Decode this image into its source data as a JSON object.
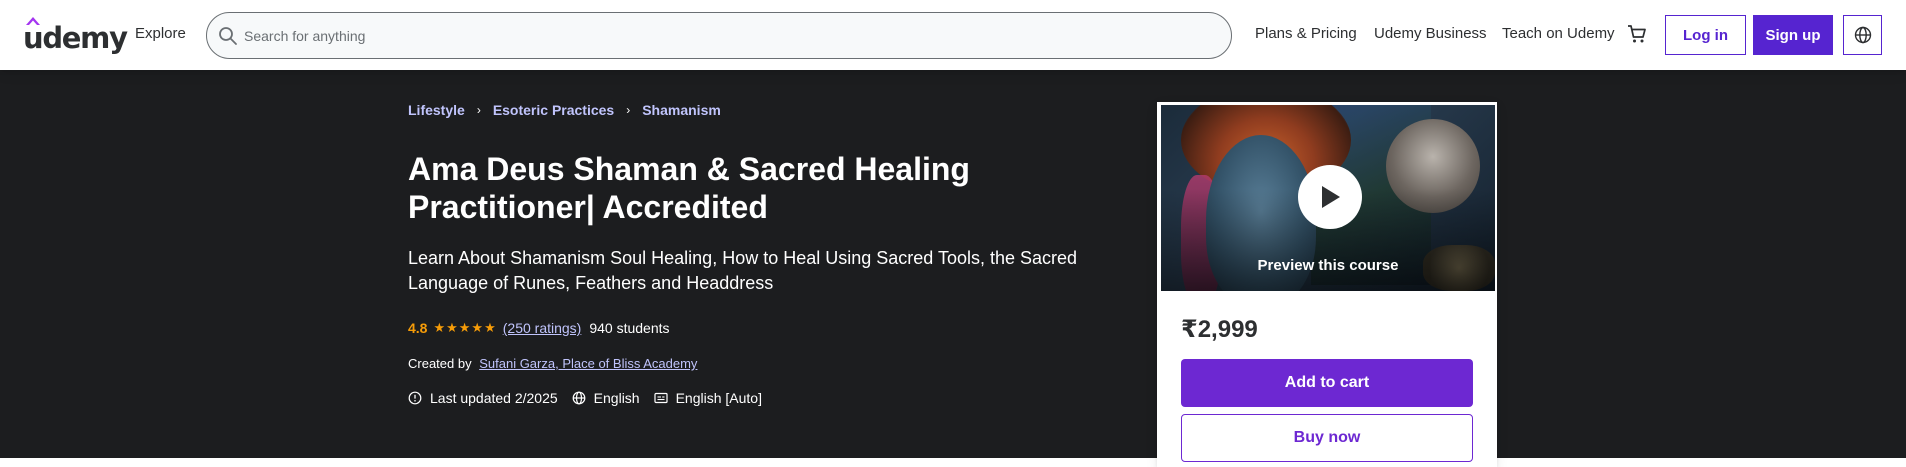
{
  "header": {
    "logo_text": "udemy",
    "explore": "Explore",
    "search_placeholder": "Search for anything",
    "nav": [
      "Plans & Pricing",
      "Udemy Business",
      "Teach on Udemy"
    ],
    "login": "Log in",
    "signup": "Sign up",
    "icons": [
      "search-icon",
      "cart-icon",
      "globe-icon"
    ]
  },
  "breadcrumbs": [
    "Lifestyle",
    "Esoteric Practices",
    "Shamanism"
  ],
  "course": {
    "title": "Ama Deus Shaman & Sacred Healing Practitioner| Accredited",
    "subtitle": "Learn About Shamanism Soul Healing, How to Heal Using Sacred Tools, the Sacred Language of Runes, Feathers and Headdress",
    "rating": "4.8",
    "stars": "★★★★★",
    "ratings_count": "(250 ratings)",
    "students": "940 students",
    "created_by_label": "Created by",
    "instructors": "Sufani Garza, Place of Bliss Academy",
    "last_updated": "Last updated 2/2025",
    "language": "English",
    "captions": "English [Auto]"
  },
  "sidebar": {
    "preview_label": "Preview this course",
    "price": "₹2,999",
    "add_to_cart": "Add to cart",
    "buy_now": "Buy now"
  },
  "colors": {
    "brand": "#5624d0",
    "cta": "#6d28d2",
    "banner": "#1c1d1f",
    "star": "#f69c08",
    "link_light": "#c0c4fc"
  }
}
